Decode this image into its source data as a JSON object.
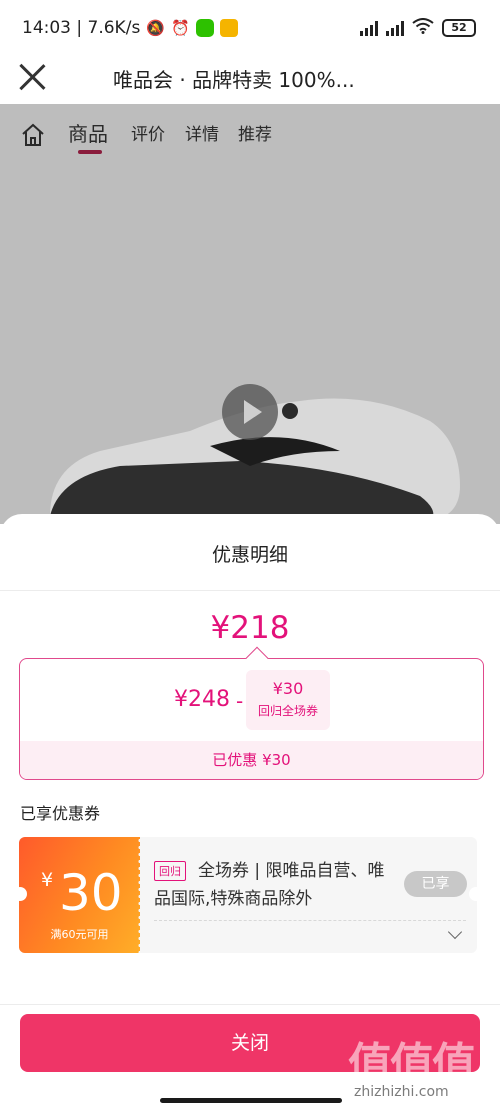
{
  "status_bar": {
    "time_speed": "14:03 | 7.6K/s",
    "battery": "52"
  },
  "header": {
    "title": "唯品会 · 品牌特卖 100%..."
  },
  "product_tabs": [
    "商品",
    "评价",
    "详情",
    "推荐"
  ],
  "sheet": {
    "title": "优惠明细",
    "final_price": "¥218",
    "original_price": "¥248",
    "minus": "-",
    "coupon_amount": "¥30",
    "coupon_label": "回归全场券",
    "saved_text": "已优惠 ¥30",
    "section_label": "已享优惠券",
    "coupon": {
      "yen": "¥",
      "amount": "30",
      "condition": "满60元可用",
      "tag": "回归",
      "description": "全场券 | 限唯品自营、唯品国际,特殊商品除外",
      "status": "已享"
    },
    "close_label": "关闭"
  },
  "watermark": {
    "chars": "值值值",
    "url": "zhizhizhi.com"
  },
  "colors": {
    "accent": "#e3127a",
    "close_button": "#ef3567",
    "coupon_orange": "#ff8a22"
  }
}
